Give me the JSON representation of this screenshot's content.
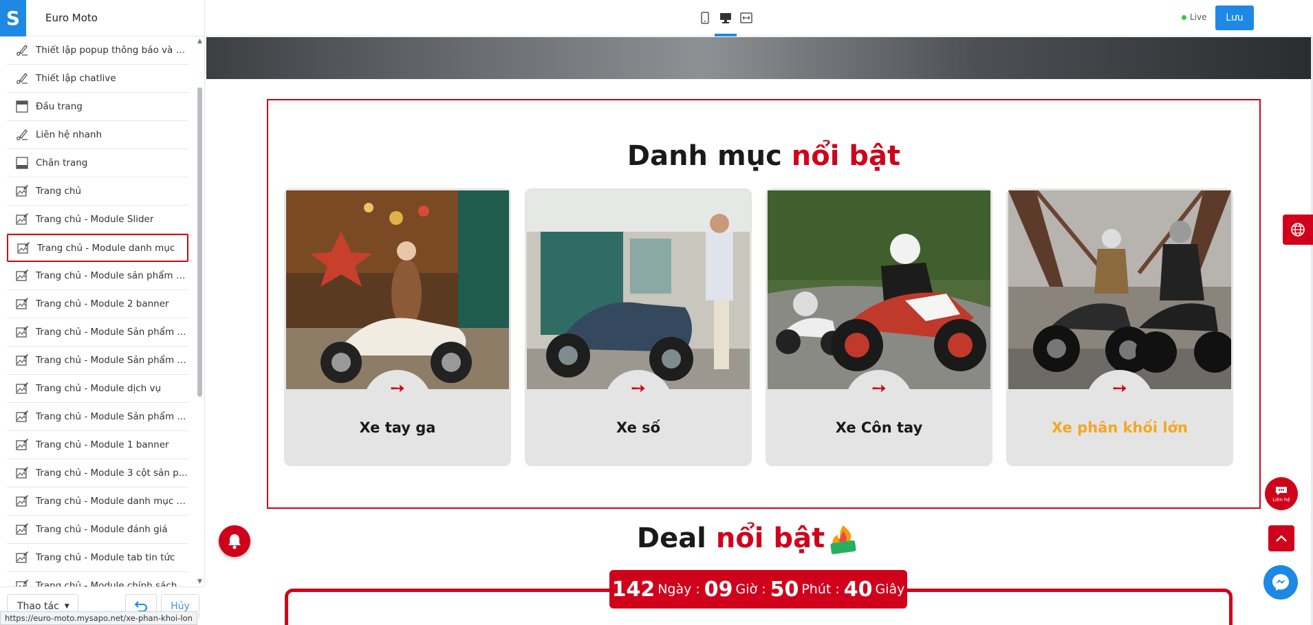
{
  "app": {
    "store_name": "Euro Moto",
    "logo_letter": "S"
  },
  "sidebar": {
    "items": [
      {
        "label": "Thiết lập popup thông báo và c...",
        "icon": "brush-icon"
      },
      {
        "label": "Thiết lập chatlive",
        "icon": "brush-icon"
      },
      {
        "label": "Đầu trang",
        "icon": "header-layout-icon"
      },
      {
        "label": "Liên hệ nhanh",
        "icon": "brush-icon"
      },
      {
        "label": "Chân trang",
        "icon": "footer-layout-icon"
      },
      {
        "label": "Trang chủ",
        "icon": "image-brush-icon"
      },
      {
        "label": "Trang chủ - Module Slider",
        "icon": "image-brush-icon"
      },
      {
        "label": "Trang chủ - Module danh mục",
        "icon": "image-brush-icon",
        "active": true
      },
      {
        "label": "Trang chủ - Module sản phẩm k...",
        "icon": "image-brush-icon"
      },
      {
        "label": "Trang chủ - Module 2 banner",
        "icon": "image-brush-icon"
      },
      {
        "label": "Trang chủ - Module Sản phẩm ...",
        "icon": "image-brush-icon"
      },
      {
        "label": "Trang chủ - Module Sản phẩm t...",
        "icon": "image-brush-icon"
      },
      {
        "label": "Trang chủ - Module dịch vụ",
        "icon": "image-brush-icon"
      },
      {
        "label": "Trang chủ - Module Sản phẩm ...",
        "icon": "image-brush-icon"
      },
      {
        "label": "Trang chủ - Module 1 banner",
        "icon": "image-brush-icon"
      },
      {
        "label": "Trang chủ - Module 3 cột sản p...",
        "icon": "image-brush-icon"
      },
      {
        "label": "Trang chủ - Module danh mục t...",
        "icon": "image-brush-icon"
      },
      {
        "label": "Trang chủ - Module đánh giá",
        "icon": "image-brush-icon"
      },
      {
        "label": "Trang chủ - Module tab tin tức",
        "icon": "image-brush-icon"
      },
      {
        "label": "Trang chủ - Module chính sách",
        "icon": "image-brush-icon"
      }
    ],
    "footer": {
      "actions_label": "Thao tác",
      "cancel_label": "Hủy"
    }
  },
  "status_url": "https://euro-moto.mysapo.net/xe-phan-khoi-lon",
  "toolbar": {
    "devices": [
      "mobile-icon",
      "desktop-icon",
      "fullwidth-icon"
    ],
    "active_device": "desktop-icon",
    "live_label": "Live",
    "save_label": "Lưu"
  },
  "preview": {
    "category_section": {
      "title_main": "Danh mục",
      "title_highlight": "nổi bật",
      "cards": [
        {
          "name": "Xe tay ga",
          "arrow": "➙"
        },
        {
          "name": "Xe số",
          "arrow": "➙"
        },
        {
          "name": "Xe Côn tay",
          "arrow": "➙"
        },
        {
          "name": "Xe phân khối lớn",
          "arrow": "➙",
          "hovered": true
        }
      ]
    },
    "deal_section": {
      "title_main": "Deal",
      "title_highlight": "nổi bật",
      "countdown": {
        "days": "142",
        "days_unit": "Ngày",
        "hours": "09",
        "hours_unit": "Giờ",
        "minutes": "50",
        "minutes_unit": "Phút",
        "seconds": "40",
        "seconds_unit": "Giây",
        "separator": ":"
      }
    },
    "floating": {
      "contact_label": "Liên hệ"
    }
  },
  "colors": {
    "accent_red": "#d0021b",
    "primary_blue": "#1e88e5",
    "hover_orange": "#f5a623",
    "live_green": "#2ecc40"
  }
}
